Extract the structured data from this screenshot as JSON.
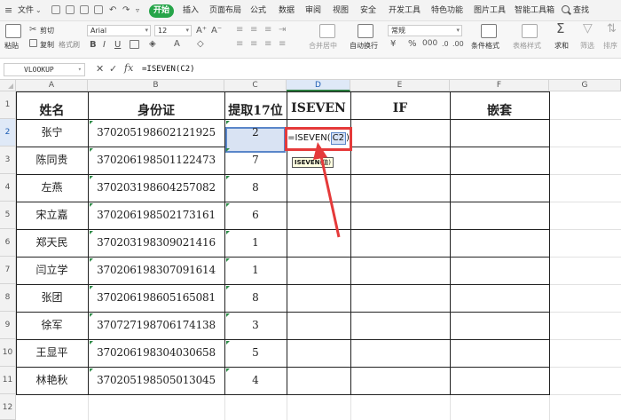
{
  "menubar": {
    "file_label": "文件",
    "tabs": [
      "开始",
      "插入",
      "页面布局",
      "公式",
      "数据",
      "审阅",
      "视图",
      "安全",
      "开发工具",
      "特色功能",
      "图片工具",
      "智能工具箱"
    ],
    "search_label": "查找"
  },
  "ribbon": {
    "cut_label": "剪切",
    "copy_label": "复制",
    "paste_label": "粘贴",
    "format_painter_label": "格式刷",
    "font_name": "Arial",
    "font_size": "12",
    "merge_label": "合并居中",
    "wrap_label": "自动换行",
    "number_format": "常规",
    "conditional_format_label": "条件格式",
    "cell_style_label": "表格样式",
    "sum_label": "求和",
    "filter_label": "筛选",
    "sort_label": "排序"
  },
  "formula_bar": {
    "name_box": "VLOOKUP",
    "fx_label": "fx",
    "formula": "=ISEVEN(C2)"
  },
  "grid": {
    "columns": [
      "A",
      "B",
      "C",
      "D",
      "E",
      "F",
      "G"
    ],
    "active_column": "D",
    "active_row": "2",
    "header_row": [
      "姓名",
      "身份证",
      "提取17位",
      "ISEVEN",
      "IF",
      "嵌套"
    ],
    "rows": [
      {
        "num": "2",
        "name": "张宁",
        "id": "370205198602121925",
        "digit": "2"
      },
      {
        "num": "3",
        "name": "陈同贵",
        "id": "370206198501122473",
        "digit": "7"
      },
      {
        "num": "4",
        "name": "左燕",
        "id": "370203198604257082",
        "digit": "8"
      },
      {
        "num": "5",
        "name": "宋立嘉",
        "id": "370206198502173161",
        "digit": "6"
      },
      {
        "num": "6",
        "name": "郑天民",
        "id": "370203198309021416",
        "digit": "1"
      },
      {
        "num": "7",
        "name": "闫立学",
        "id": "370206198307091614",
        "digit": "1"
      },
      {
        "num": "8",
        "name": "张团",
        "id": "370206198605165081",
        "digit": "8"
      },
      {
        "num": "9",
        "name": "徐军",
        "id": "370727198706174138",
        "digit": "3"
      },
      {
        "num": "10",
        "name": "王显平",
        "id": "370206198304030658",
        "digit": "5"
      },
      {
        "num": "11",
        "name": "林艳秋",
        "id": "370205198505013045",
        "digit": "4"
      }
    ],
    "row_numbers": [
      "1",
      "2",
      "3",
      "4",
      "5",
      "6",
      "7",
      "8",
      "9",
      "10",
      "11",
      "12"
    ],
    "editing_cell": {
      "prefix": "=ISEVEN(",
      "ref": "C2",
      "suffix": ")"
    },
    "tooltip": {
      "func": "ISEVEN",
      "arg": "(值)"
    }
  },
  "colors": {
    "accent": "#27a54a",
    "highlight_box": "#e53a3a",
    "selection": "#d9e3f3"
  }
}
